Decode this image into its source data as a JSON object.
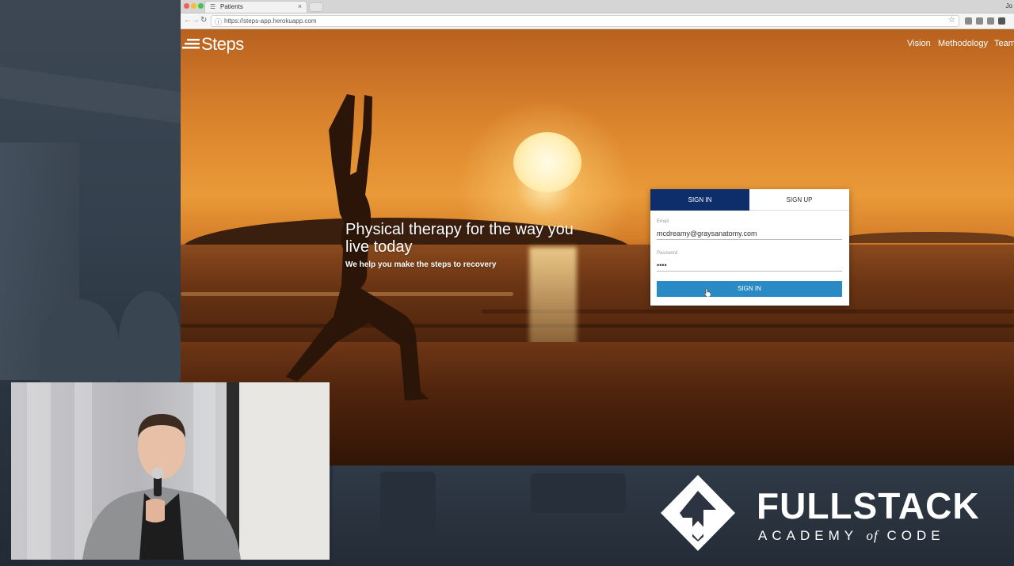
{
  "browser": {
    "tab_title": "Patients",
    "tab_close": "×",
    "url": "https://steps-app.herokuapp.com",
    "user_initial": "Jo"
  },
  "site": {
    "brand": "Steps",
    "nav": [
      "Vision",
      "Methodology",
      "Team"
    ],
    "hero_title": "Physical therapy for the way you live today",
    "hero_subtitle": "We help you make the steps to recovery"
  },
  "login_card": {
    "tab_active": "SIGN IN",
    "tab_inactive": "SIGN UP",
    "email_label": "Email",
    "email_value": "mcdreamy@graysanatomy.com",
    "password_label": "Password",
    "password_value": "••••",
    "submit_label": "SIGN IN"
  },
  "overlay": {
    "logo_title": "FULLSTACK",
    "logo_sub_prefix": "ACADEMY",
    "logo_sub_of": "of",
    "logo_sub_suffix": "CODE"
  },
  "colors": {
    "card_tab_active": "#0d2e6b",
    "submit_button": "#2a8bc4",
    "sunset": "#ea9a38"
  }
}
